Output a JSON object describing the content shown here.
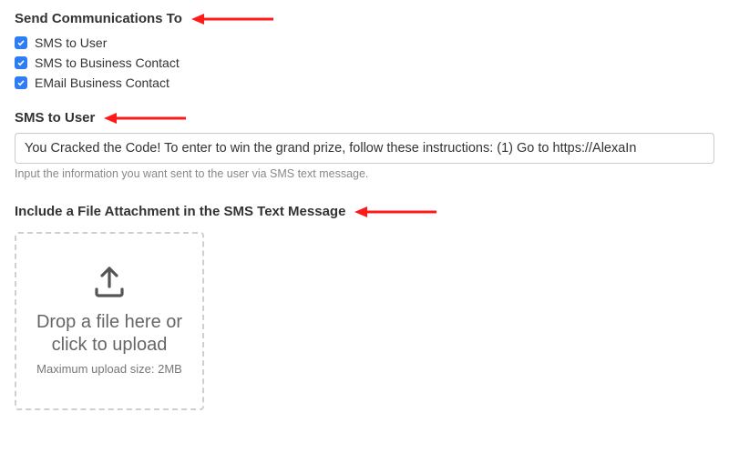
{
  "sections": {
    "send_to_heading": "Send Communications To",
    "sms_to_user_heading": "SMS to User",
    "attachment_heading": "Include a File Attachment in the SMS Text Message"
  },
  "checkboxes": {
    "sms_user": {
      "label": "SMS to User",
      "checked": true
    },
    "sms_business": {
      "label": "SMS to Business Contact",
      "checked": true
    },
    "email_business": {
      "label": "EMail Business Contact",
      "checked": true
    }
  },
  "sms_input": {
    "value": "You Cracked the Code! To enter to win the grand prize, follow these instructions: (1) Go to https://AlexaIn",
    "help": "Input the information you want sent to the user via SMS text message."
  },
  "dropzone": {
    "main_line": "Drop a file here or click to upload",
    "sub_line": "Maximum upload size: 2MB"
  },
  "colors": {
    "arrow": "#ff1a1a",
    "checkbox_bg": "#2e7cf6"
  }
}
